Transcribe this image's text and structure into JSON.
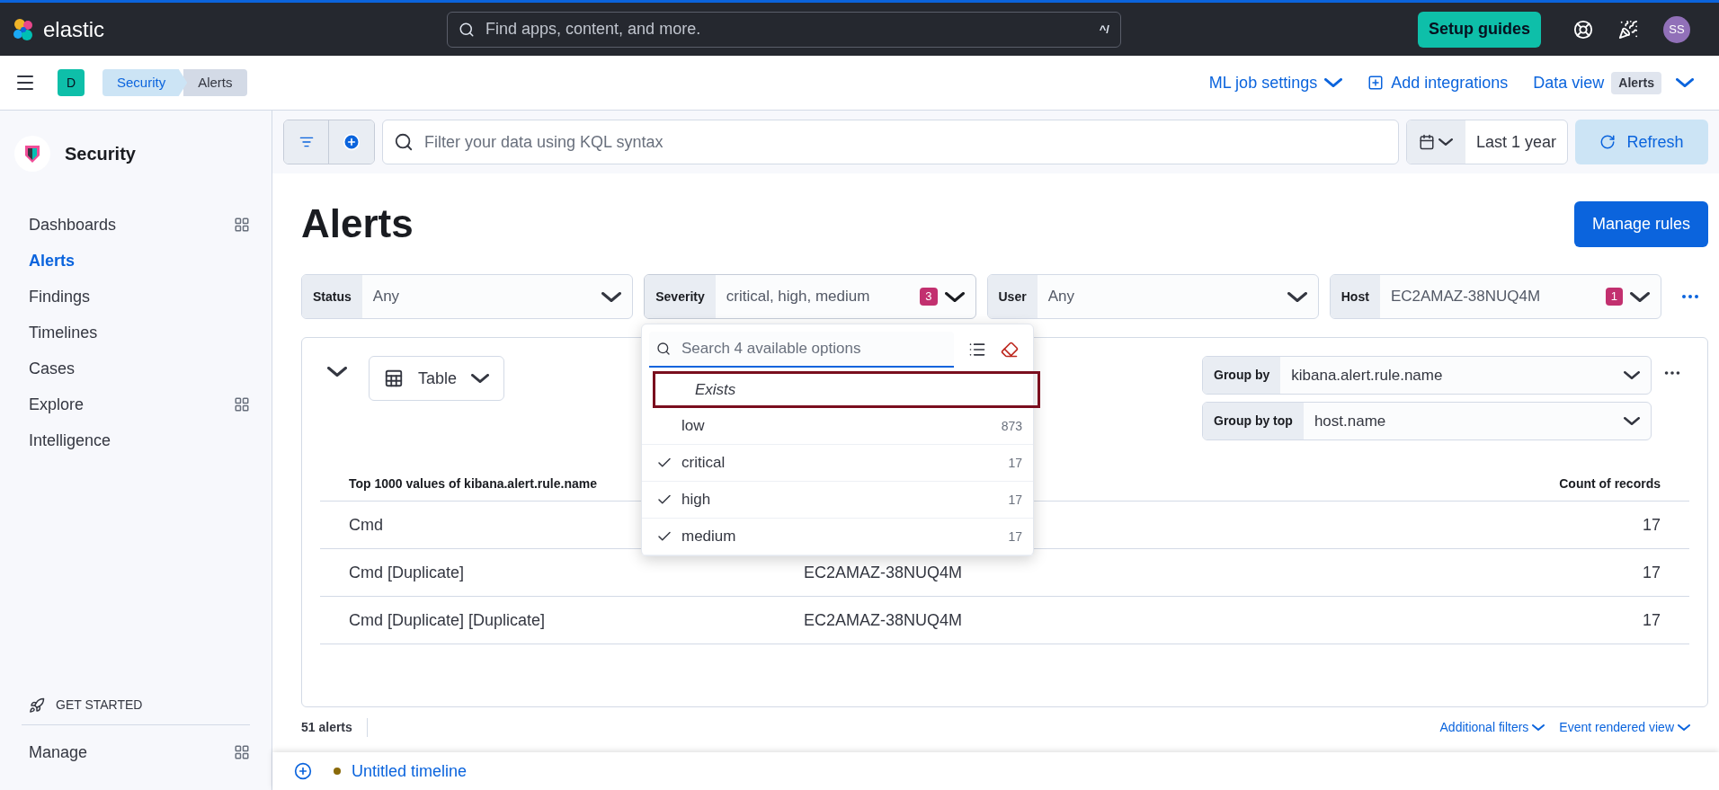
{
  "header": {
    "logo_text": "elastic",
    "search_placeholder": "Find apps, content, and more.",
    "shortcut": "^/",
    "setup_button": "Setup guides",
    "avatar": "SS"
  },
  "nav_bar": {
    "space": "D",
    "breadcrumbs": [
      {
        "label": "Security",
        "selected": false
      },
      {
        "label": "Alerts",
        "selected": true
      }
    ],
    "links": [
      {
        "label": "ML job settings",
        "kind": "dropdown"
      },
      {
        "label": "Add integrations",
        "kind": "add"
      }
    ],
    "data_view": {
      "label": "Data view",
      "value": "Alerts"
    }
  },
  "sidebar": {
    "title": "Security",
    "items": [
      {
        "label": "Dashboards",
        "selected": false,
        "kind": "grid"
      },
      {
        "label": "Alerts",
        "selected": true,
        "kind": "plain"
      },
      {
        "label": "Findings",
        "selected": false,
        "kind": "plain"
      },
      {
        "label": "Timelines",
        "selected": false,
        "kind": "plain"
      },
      {
        "label": "Cases",
        "selected": false,
        "kind": "plain"
      },
      {
        "label": "Explore",
        "selected": false,
        "kind": "grid"
      },
      {
        "label": "Intelligence",
        "selected": false,
        "kind": "plain"
      }
    ],
    "get_started": "GET STARTED",
    "manage": "Manage"
  },
  "query_bar": {
    "placeholder": "Filter your data using KQL syntax",
    "date_range": "Last 1 year",
    "refresh": "Refresh"
  },
  "page": {
    "title": "Alerts",
    "manage_button": "Manage rules"
  },
  "filters": [
    {
      "label": "Status",
      "value": "Any",
      "open": false
    },
    {
      "label": "Severity",
      "value": "critical, high, medium",
      "count": "3",
      "open": true
    },
    {
      "label": "User",
      "value": "Any",
      "open": false
    },
    {
      "label": "Host",
      "value": "EC2AMAZ-38NUQ4M",
      "count": "1",
      "open": false
    }
  ],
  "severity_popover": {
    "search_placeholder": "Search 4 available options",
    "options": [
      {
        "label": "Exists",
        "kind": "exists",
        "highlighted": true
      },
      {
        "label": "low",
        "count": "873",
        "checked": false,
        "kind": "value",
        "highlighted": false
      },
      {
        "label": "critical",
        "count": "17",
        "checked": true,
        "kind": "value",
        "highlighted": false
      },
      {
        "label": "high",
        "count": "17",
        "checked": true,
        "kind": "value",
        "highlighted": false
      },
      {
        "label": "medium",
        "count": "17",
        "checked": true,
        "kind": "value",
        "highlighted": false
      }
    ]
  },
  "grouping": {
    "view": "Table",
    "group_by": {
      "label": "Group by",
      "value": "kibana.alert.rule.name"
    },
    "group_by_top": {
      "label": "Group by top",
      "value": "host.name"
    }
  },
  "table": {
    "columns": [
      {
        "label": "Top 1000 values of kibana.alert.rule.name"
      },
      {
        "label": "Count of records"
      }
    ],
    "rows": [
      {
        "name": "Cmd",
        "count": "17"
      },
      {
        "name": "Cmd [Duplicate]",
        "host": "EC2AMAZ-38NUQ4M",
        "count": "17"
      },
      {
        "name": "Cmd [Duplicate] [Duplicate]",
        "host": "EC2AMAZ-38NUQ4M",
        "count": "17"
      }
    ]
  },
  "footer": {
    "count": "51 alerts",
    "links": [
      "Additional filters",
      "Event rendered view"
    ]
  },
  "timeline": {
    "title": "Untitled timeline"
  }
}
